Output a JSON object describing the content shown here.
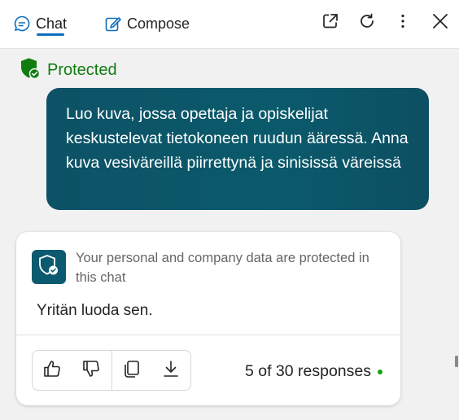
{
  "header": {
    "tabs": [
      {
        "label": "Chat",
        "icon": "chat-bubble-icon",
        "active": true
      },
      {
        "label": "Compose",
        "icon": "compose-edit-icon",
        "active": false
      }
    ],
    "actions": [
      "open-in-new-window-icon",
      "refresh-icon",
      "more-options-icon",
      "close-icon"
    ]
  },
  "status": {
    "label": "Protected",
    "icon": "shield-check-icon",
    "color": "#107c10"
  },
  "conversation": {
    "user_message": "Luo kuva, jossa opettaja ja opiskelijat keskustelevat tietokoneen ruudun ääressä. Anna kuva vesiväreillä piirrettynä ja sinisissä väreissä",
    "assistant": {
      "notice": "Your personal and company data are protected in this chat",
      "reply": "Yritän luoda sen.",
      "actions": [
        "thumbs-up-icon",
        "thumbs-down-icon",
        "copy-icon",
        "download-icon"
      ],
      "response_count": "5 of 30 responses"
    }
  },
  "colors": {
    "accent": "#0f6cbd",
    "bubble": "#0a5a6b",
    "indicator": "#13a10e"
  }
}
